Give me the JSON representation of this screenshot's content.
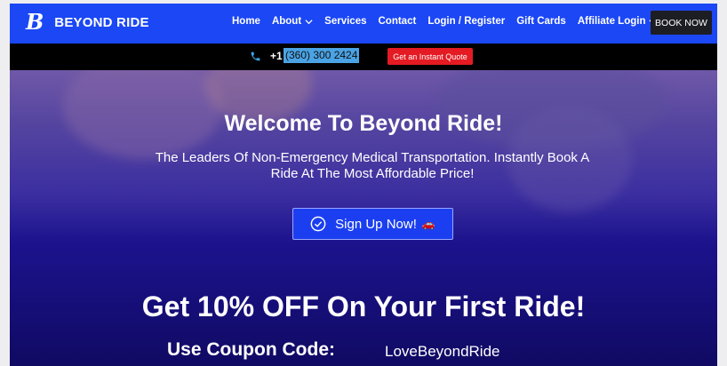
{
  "header": {
    "brand": "BEYOND RIDE",
    "logo_letter": "B",
    "nav": [
      {
        "label": "Home",
        "has_dropdown": false
      },
      {
        "label": "About",
        "has_dropdown": true
      },
      {
        "label": "Services",
        "has_dropdown": false
      },
      {
        "label": "Contact",
        "has_dropdown": false
      },
      {
        "label": "Login / Register",
        "has_dropdown": false
      },
      {
        "label": "Gift Cards",
        "has_dropdown": false
      },
      {
        "label": "Affiliate Login",
        "has_dropdown": true
      }
    ],
    "book_now": "BOOK NOW"
  },
  "topbar": {
    "phone_prefix": "+1",
    "phone_number": "(360) 300 2424",
    "quote_button": "Get an Instant Quote"
  },
  "hero": {
    "title": "Welcome To Beyond Ride!",
    "subtitle": "The Leaders Of Non-Emergency Medical Transportation. Instantly Book A Ride At The Most Affordable Price!",
    "signup_button": "Sign Up Now!",
    "offer_title": "Get 10% OFF On Your First Ride!",
    "coupon_label": "Use Coupon Code:",
    "coupon_code": "LoveBeyondRide"
  },
  "colors": {
    "header_bg": "#1b47f5",
    "topbar_bg": "#000000",
    "quote_button_bg": "#e41b23",
    "phone_highlight": "#4aa3e4",
    "hero_bottom": "#100a63",
    "signup_button_bg": "#1b3ff0",
    "book_button_bg": "#1d1d24"
  },
  "icons": {
    "phone": "phone-icon",
    "check": "check-circle-icon",
    "car": "car-icon",
    "chevron": "chevron-down-icon"
  }
}
